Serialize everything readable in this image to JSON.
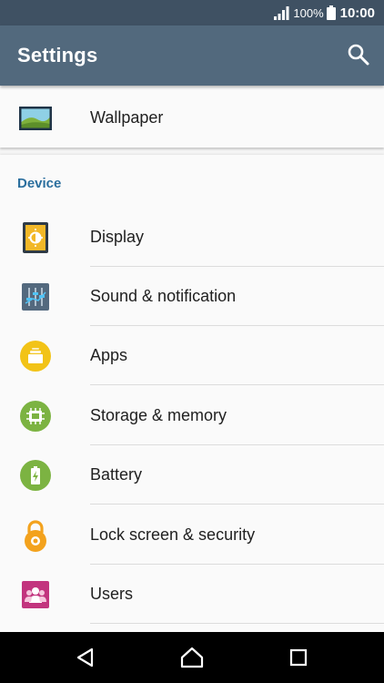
{
  "status_bar": {
    "battery_percent": "100%",
    "time": "10:00"
  },
  "app_bar": {
    "title": "Settings"
  },
  "colors": {
    "status_bar": "#3f5163",
    "app_bar": "#52697d",
    "section_header": "#2b6f9e"
  },
  "top_items": [
    {
      "label": "Wallpaper",
      "icon": "wallpaper-icon"
    }
  ],
  "section": {
    "title": "Device"
  },
  "items": [
    {
      "label": "Display",
      "icon": "display-icon"
    },
    {
      "label": "Sound & notification",
      "icon": "sound-icon"
    },
    {
      "label": "Apps",
      "icon": "apps-icon"
    },
    {
      "label": "Storage & memory",
      "icon": "storage-icon"
    },
    {
      "label": "Battery",
      "icon": "battery-icon"
    },
    {
      "label": "Lock screen & security",
      "icon": "lock-icon"
    },
    {
      "label": "Users",
      "icon": "users-icon"
    }
  ],
  "nav_bar": {
    "buttons": [
      "back-icon",
      "home-icon",
      "recents-icon"
    ]
  }
}
